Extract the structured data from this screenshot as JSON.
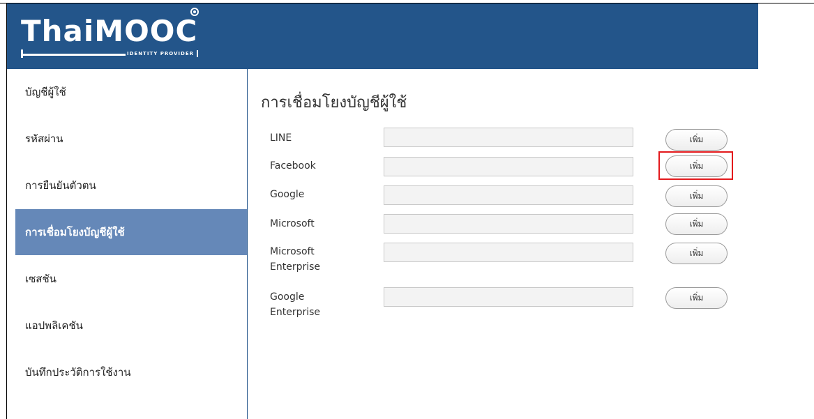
{
  "brand": {
    "logo_text": "ThaiMOOC",
    "logo_subtitle": "IDENTITY PROVIDER"
  },
  "sidebar": {
    "items": [
      {
        "label": "บัญชีผู้ใช้",
        "active": false
      },
      {
        "label": "รหัสผ่าน",
        "active": false
      },
      {
        "label": "การยืนยันตัวตน",
        "active": false
      },
      {
        "label": "การเชื่อมโยงบัญชีผู้ใช้",
        "active": true
      },
      {
        "label": "เซสชัน",
        "active": false
      },
      {
        "label": "แอปพลิเคชัน",
        "active": false
      },
      {
        "label": "บันทึกประวัติการใช้งาน",
        "active": false
      }
    ]
  },
  "main": {
    "title": "การเชื่อมโยงบัญชีผู้ใช้",
    "providers": [
      {
        "label": "LINE",
        "value": "",
        "button": "เพิ่ม"
      },
      {
        "label": "Facebook",
        "value": "",
        "button": "เพิ่ม"
      },
      {
        "label": "Google",
        "value": "",
        "button": "เพิ่ม"
      },
      {
        "label": "Microsoft",
        "value": "",
        "button": "เพิ่ม"
      },
      {
        "label": "Microsoft\nEnterprise",
        "value": "",
        "button": "เพิ่ม"
      },
      {
        "label": "Google\nEnterprise",
        "value": "",
        "button": "เพิ่ม"
      }
    ]
  },
  "colors": {
    "header_bg": "#23558a",
    "sidebar_active_bg": "#6588b8",
    "highlight_border": "#e3191c"
  }
}
